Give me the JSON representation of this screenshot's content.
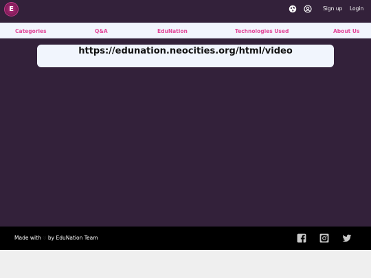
{
  "header": {
    "logo_letter": "E",
    "signup_label": "Sign up",
    "login_label": "Login"
  },
  "nav": {
    "items": [
      {
        "label": "Categories"
      },
      {
        "label": "Q&A"
      },
      {
        "label": "EduNation"
      },
      {
        "label": "Technologies Used"
      },
      {
        "label": "About Us"
      }
    ]
  },
  "main": {
    "url_text": "https://edunation.neocities.org/html/video"
  },
  "footer": {
    "made_with": "Made with",
    "heart": "♡",
    "by_team": "by EduNation Team"
  },
  "colors": {
    "header_bg": "#33213a",
    "nav_bg": "#f1f5fd",
    "nav_text": "#e2479a",
    "footer_bg": "#000000"
  },
  "icons": [
    "globe-icon",
    "user-circle-icon",
    "facebook-icon",
    "instagram-icon",
    "twitter-icon"
  ]
}
